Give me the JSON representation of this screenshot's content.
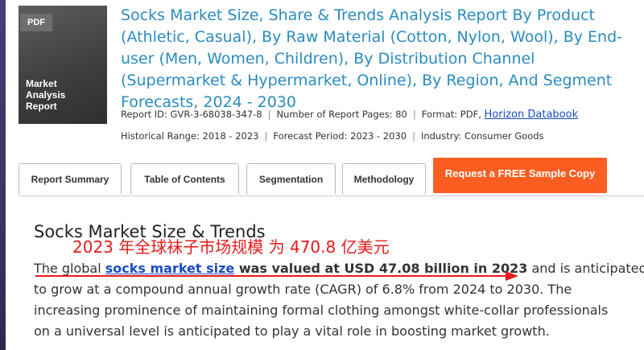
{
  "cover": {
    "badge": "PDF",
    "label_lines": [
      "Market",
      "Analysis",
      "Report"
    ]
  },
  "report": {
    "title": "Socks Market Size, Share & Trends Analysis Report By Product (Athletic, Casual), By Raw Material (Cotton, Nylon, Wool), By End-user (Men, Women, Children), By Distribution Channel (Supermarket & Hypermarket, Online), By Region, And Segment Forecasts, 2024 - 2030",
    "meta": {
      "report_id": "Report ID: GVR-3-68038-347-8",
      "pages": "Number of Report Pages: 80",
      "format_label": "Format: PDF,",
      "format_link": "Horizon Databook",
      "historical_range": "Historical Range: 2018 - 2023",
      "forecast_period": "Forecast Period: 2023 - 2030",
      "industry": "Industry: Consumer Goods"
    }
  },
  "tabs": [
    {
      "label": "Report Summary"
    },
    {
      "label": "Table of Contents"
    },
    {
      "label": "Segmentation"
    },
    {
      "label": "Methodology"
    }
  ],
  "sample_button": {
    "label": "Request a FREE Sample Copy"
  },
  "content": {
    "heading": "Socks Market Size & Trends",
    "annotation": "2023 年全球袜子市场规模 为 470.8 亿美元",
    "para": {
      "l1_prefix": "The global ",
      "l1_link": "socks market size",
      "l1_bold": " was valued at USD 47.08 billion in 2023",
      "l1_suffix": " and is anticipated",
      "l2": "to grow at a compound annual growth rate (CAGR) of 6.8% from 2024 to 2030. The",
      "l3": "increasing prominence of maintaining formal clothing amongst white-collar professionals",
      "l4": "on a universal level is anticipated to play a vital role in boosting market growth."
    }
  },
  "colors": {
    "title_blue": "#2a8bbf",
    "link_blue": "#1a4bc4",
    "cta_orange": "#fb5e20",
    "annotation_red": "#e81a1a",
    "cover_gray": "#3f3f3f",
    "strip_purple": "#4a3a78"
  }
}
